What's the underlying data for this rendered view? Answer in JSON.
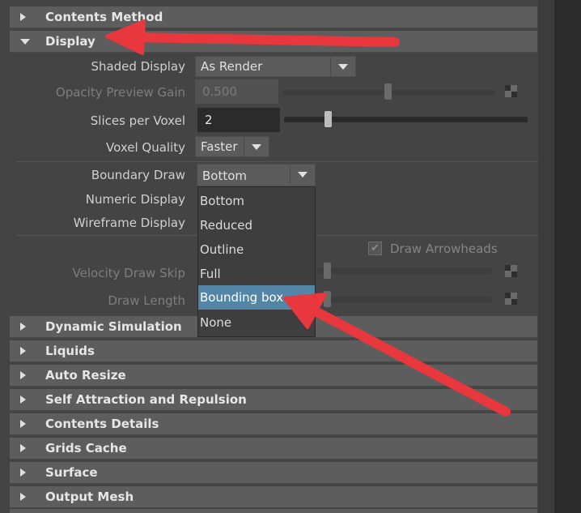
{
  "sections_top": [
    {
      "label": "Contents Method",
      "expanded": false
    },
    {
      "label": "Display",
      "expanded": true
    }
  ],
  "display": {
    "shaded_display": {
      "label": "Shaded Display",
      "value": "As Render"
    },
    "opacity_preview_gain": {
      "label": "Opacity Preview Gain",
      "value": "0.500",
      "slider_fraction": 0.5
    },
    "slices_per_voxel": {
      "label": "Slices per Voxel",
      "value": "2",
      "slider_fraction": 0.18
    },
    "voxel_quality": {
      "label": "Voxel Quality",
      "value": "Faster"
    },
    "boundary_draw": {
      "label": "Boundary Draw",
      "value": "Bottom"
    },
    "numeric_display": {
      "label": "Numeric Display"
    },
    "wireframe_display": {
      "label": "Wireframe Display"
    },
    "draw_arrowheads": {
      "label": "Draw Arrowheads",
      "checked": true
    },
    "velocity_draw_skip": {
      "label": "Velocity Draw Skip"
    },
    "draw_length": {
      "label": "Draw Length"
    }
  },
  "boundary_draw_menu": {
    "options": [
      "Bottom",
      "Reduced",
      "Outline",
      "Full",
      "Bounding box",
      "None"
    ],
    "highlighted": "Bounding box"
  },
  "sections_bottom": [
    {
      "label": "Dynamic Simulation"
    },
    {
      "label": "Liquids"
    },
    {
      "label": "Auto Resize"
    },
    {
      "label": "Self Attraction and Repulsion"
    },
    {
      "label": "Contents Details"
    },
    {
      "label": "Grids Cache"
    },
    {
      "label": "Surface"
    },
    {
      "label": "Output Mesh"
    }
  ],
  "colors": {
    "annotation_arrow": "#e8383d",
    "highlight": "#5285a6"
  }
}
